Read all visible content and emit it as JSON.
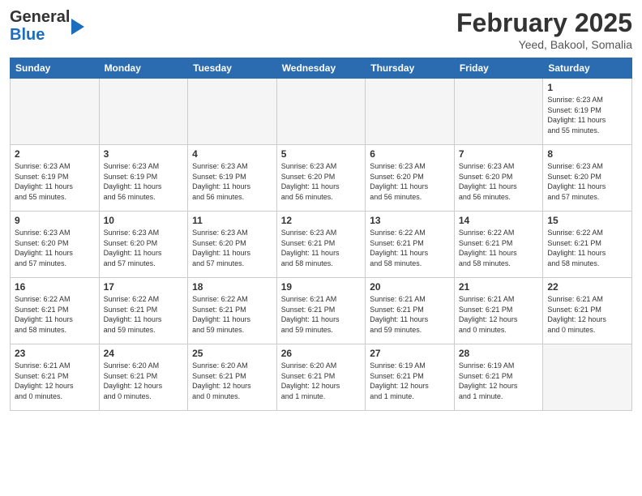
{
  "header": {
    "logo_line1": "General",
    "logo_line2": "Blue",
    "month_title": "February 2025",
    "location": "Yeed, Bakool, Somalia"
  },
  "weekdays": [
    "Sunday",
    "Monday",
    "Tuesday",
    "Wednesday",
    "Thursday",
    "Friday",
    "Saturday"
  ],
  "weeks": [
    [
      {
        "day": "",
        "info": ""
      },
      {
        "day": "",
        "info": ""
      },
      {
        "day": "",
        "info": ""
      },
      {
        "day": "",
        "info": ""
      },
      {
        "day": "",
        "info": ""
      },
      {
        "day": "",
        "info": ""
      },
      {
        "day": "1",
        "info": "Sunrise: 6:23 AM\nSunset: 6:19 PM\nDaylight: 11 hours\nand 55 minutes."
      }
    ],
    [
      {
        "day": "2",
        "info": "Sunrise: 6:23 AM\nSunset: 6:19 PM\nDaylight: 11 hours\nand 55 minutes."
      },
      {
        "day": "3",
        "info": "Sunrise: 6:23 AM\nSunset: 6:19 PM\nDaylight: 11 hours\nand 56 minutes."
      },
      {
        "day": "4",
        "info": "Sunrise: 6:23 AM\nSunset: 6:19 PM\nDaylight: 11 hours\nand 56 minutes."
      },
      {
        "day": "5",
        "info": "Sunrise: 6:23 AM\nSunset: 6:20 PM\nDaylight: 11 hours\nand 56 minutes."
      },
      {
        "day": "6",
        "info": "Sunrise: 6:23 AM\nSunset: 6:20 PM\nDaylight: 11 hours\nand 56 minutes."
      },
      {
        "day": "7",
        "info": "Sunrise: 6:23 AM\nSunset: 6:20 PM\nDaylight: 11 hours\nand 56 minutes."
      },
      {
        "day": "8",
        "info": "Sunrise: 6:23 AM\nSunset: 6:20 PM\nDaylight: 11 hours\nand 57 minutes."
      }
    ],
    [
      {
        "day": "9",
        "info": "Sunrise: 6:23 AM\nSunset: 6:20 PM\nDaylight: 11 hours\nand 57 minutes."
      },
      {
        "day": "10",
        "info": "Sunrise: 6:23 AM\nSunset: 6:20 PM\nDaylight: 11 hours\nand 57 minutes."
      },
      {
        "day": "11",
        "info": "Sunrise: 6:23 AM\nSunset: 6:20 PM\nDaylight: 11 hours\nand 57 minutes."
      },
      {
        "day": "12",
        "info": "Sunrise: 6:23 AM\nSunset: 6:21 PM\nDaylight: 11 hours\nand 58 minutes."
      },
      {
        "day": "13",
        "info": "Sunrise: 6:22 AM\nSunset: 6:21 PM\nDaylight: 11 hours\nand 58 minutes."
      },
      {
        "day": "14",
        "info": "Sunrise: 6:22 AM\nSunset: 6:21 PM\nDaylight: 11 hours\nand 58 minutes."
      },
      {
        "day": "15",
        "info": "Sunrise: 6:22 AM\nSunset: 6:21 PM\nDaylight: 11 hours\nand 58 minutes."
      }
    ],
    [
      {
        "day": "16",
        "info": "Sunrise: 6:22 AM\nSunset: 6:21 PM\nDaylight: 11 hours\nand 58 minutes."
      },
      {
        "day": "17",
        "info": "Sunrise: 6:22 AM\nSunset: 6:21 PM\nDaylight: 11 hours\nand 59 minutes."
      },
      {
        "day": "18",
        "info": "Sunrise: 6:22 AM\nSunset: 6:21 PM\nDaylight: 11 hours\nand 59 minutes."
      },
      {
        "day": "19",
        "info": "Sunrise: 6:21 AM\nSunset: 6:21 PM\nDaylight: 11 hours\nand 59 minutes."
      },
      {
        "day": "20",
        "info": "Sunrise: 6:21 AM\nSunset: 6:21 PM\nDaylight: 11 hours\nand 59 minutes."
      },
      {
        "day": "21",
        "info": "Sunrise: 6:21 AM\nSunset: 6:21 PM\nDaylight: 12 hours\nand 0 minutes."
      },
      {
        "day": "22",
        "info": "Sunrise: 6:21 AM\nSunset: 6:21 PM\nDaylight: 12 hours\nand 0 minutes."
      }
    ],
    [
      {
        "day": "23",
        "info": "Sunrise: 6:21 AM\nSunset: 6:21 PM\nDaylight: 12 hours\nand 0 minutes."
      },
      {
        "day": "24",
        "info": "Sunrise: 6:20 AM\nSunset: 6:21 PM\nDaylight: 12 hours\nand 0 minutes."
      },
      {
        "day": "25",
        "info": "Sunrise: 6:20 AM\nSunset: 6:21 PM\nDaylight: 12 hours\nand 0 minutes."
      },
      {
        "day": "26",
        "info": "Sunrise: 6:20 AM\nSunset: 6:21 PM\nDaylight: 12 hours\nand 1 minute."
      },
      {
        "day": "27",
        "info": "Sunrise: 6:19 AM\nSunset: 6:21 PM\nDaylight: 12 hours\nand 1 minute."
      },
      {
        "day": "28",
        "info": "Sunrise: 6:19 AM\nSunset: 6:21 PM\nDaylight: 12 hours\nand 1 minute."
      },
      {
        "day": "",
        "info": ""
      }
    ]
  ]
}
